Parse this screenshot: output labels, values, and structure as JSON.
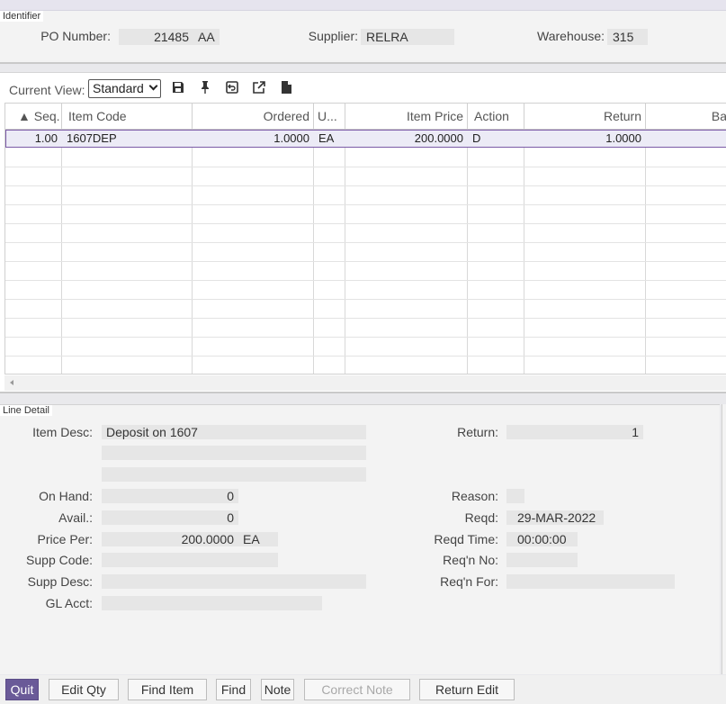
{
  "identifier": {
    "section_label": "Identifier",
    "po_number_label": "PO Number:",
    "po_number": "21485",
    "po_suffix": "AA",
    "supplier_label": "Supplier:",
    "supplier": "RELRA",
    "warehouse_label": "Warehouse:",
    "warehouse": "315"
  },
  "toolbar": {
    "current_view_label": "Current View:",
    "current_view": "Standard",
    "icons": [
      "save-icon",
      "pin-icon",
      "restore-icon",
      "export-icon",
      "document-icon"
    ]
  },
  "grid": {
    "columns": [
      "▲ Seq.",
      "Item Code",
      "Ordered",
      "U...",
      "Item Price",
      "Action",
      "Return",
      "Ba"
    ],
    "rows": [
      {
        "seq": "1.00",
        "item_code": "1607DEP",
        "ordered": "1.0000",
        "uom": "EA",
        "item_price": "200.0000",
        "action": "D",
        "return": "1.0000",
        "ba": ""
      }
    ]
  },
  "line_detail": {
    "section_label": "Line Detail",
    "item_desc_label": "Item Desc:",
    "item_desc": "Deposit on 1607",
    "item_desc2": "",
    "item_desc3": "",
    "on_hand_label": "On Hand:",
    "on_hand": "0",
    "avail_label": "Avail.:",
    "avail": "0",
    "price_per_label": "Price Per:",
    "price_per": "200.0000",
    "price_uom": "EA",
    "supp_code_label": "Supp Code:",
    "supp_code": "",
    "supp_desc_label": "Supp Desc:",
    "supp_desc": "",
    "gl_acct_label": "GL Acct:",
    "gl_acct": "",
    "return_label": "Return:",
    "return": "1",
    "reason_label": "Reason:",
    "reason": "",
    "reqd_label": "Reqd:",
    "reqd": "29-MAR-2022",
    "reqd_time_label": "Reqd Time:",
    "reqd_time": "00:00:00",
    "reqn_no_label": "Req'n No:",
    "reqn_no": "",
    "reqn_for_label": "Req'n For:",
    "reqn_for": ""
  },
  "buttons": {
    "quit": "Quit",
    "edit_qty": "Edit Qty",
    "find_item": "Find Item",
    "find": "Find",
    "note": "Note",
    "correct_note": "Correct Note",
    "return_edit": "Return Edit"
  },
  "colors": {
    "accent": "#6a5a98",
    "selection_border": "#7b5aa6",
    "field_bg": "#e6e6e6"
  }
}
